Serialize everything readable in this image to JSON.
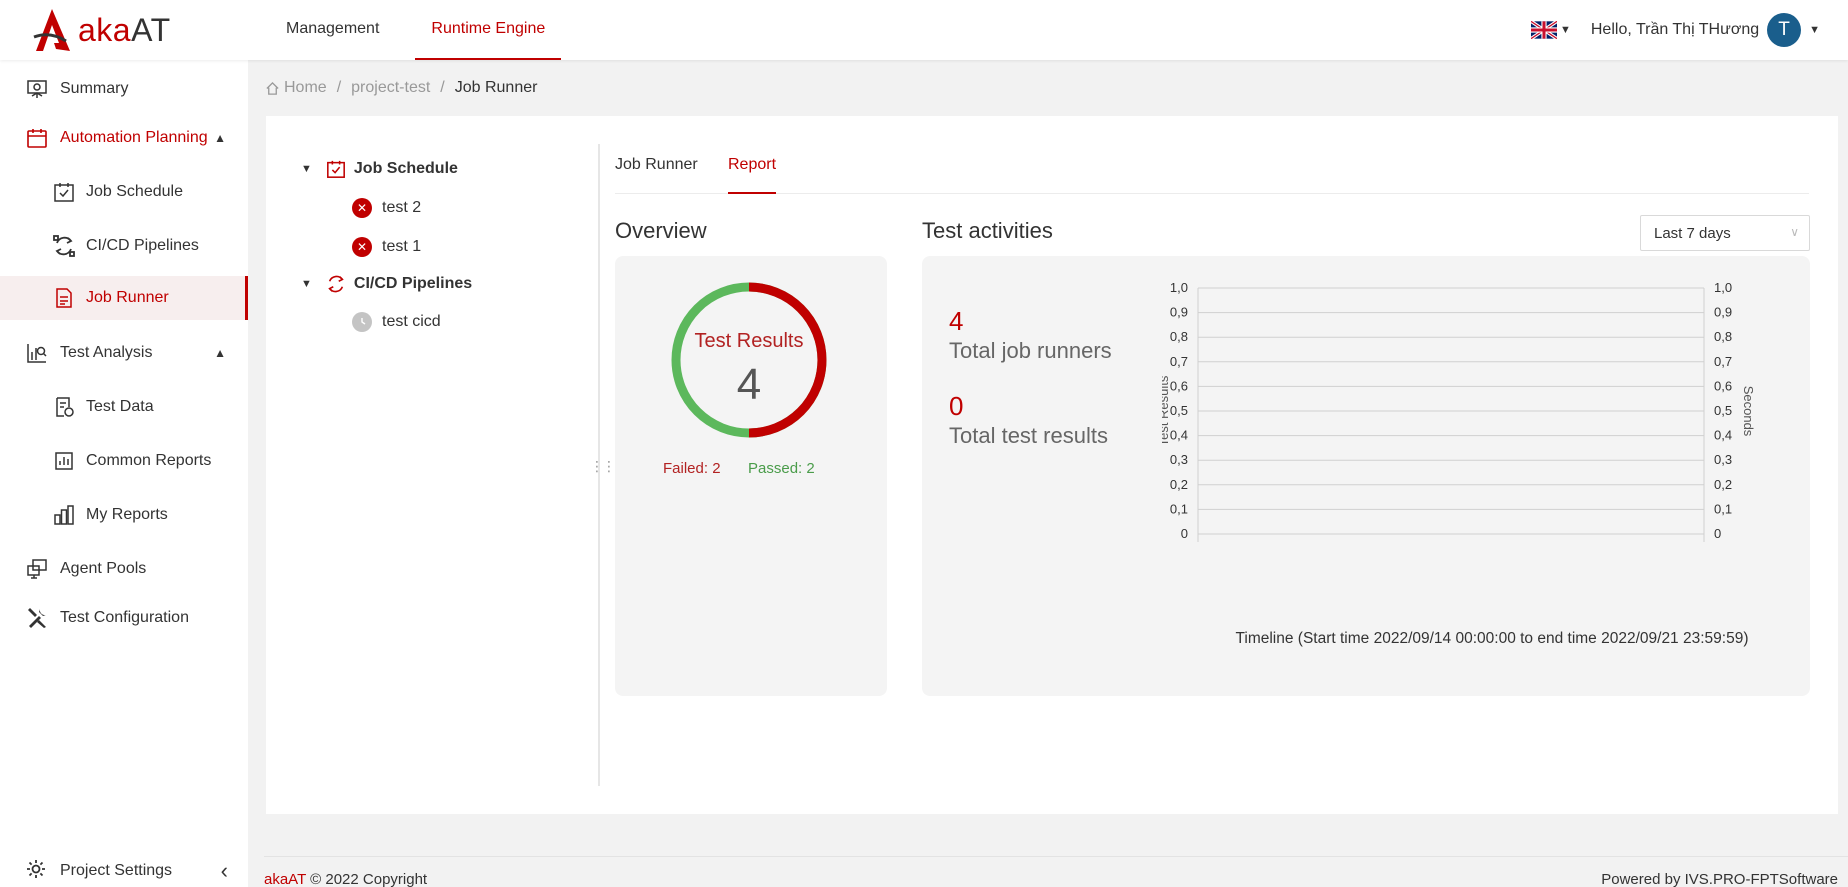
{
  "app": {
    "logo_letter": "A",
    "logo_brand_prefix": "aka",
    "logo_brand_suffix": "AT"
  },
  "topnav": {
    "items": [
      {
        "label": "Management",
        "active": false
      },
      {
        "label": "Runtime Engine",
        "active": true
      }
    ]
  },
  "user": {
    "greeting": "Hello, Trần Thị THương",
    "avatar_initial": "T",
    "avatar_color": "#1a5e8c",
    "language_icon": "uk-flag-icon"
  },
  "sidebar": {
    "summary": "Summary",
    "automation_planning": "Automation Planning",
    "job_schedule": "Job Schedule",
    "cicd_pipelines": "CI/CD Pipelines",
    "job_runner": "Job Runner",
    "test_analysis": "Test Analysis",
    "test_data": "Test Data",
    "common_reports": "Common Reports",
    "my_reports": "My Reports",
    "agent_pools": "Agent Pools",
    "test_configuration": "Test Configuration",
    "project_settings": "Project Settings",
    "active_item": "Job Runner",
    "active_color": "#c00000"
  },
  "breadcrumb": {
    "home": "Home",
    "project": "project-test",
    "current": "Job Runner"
  },
  "tree": {
    "job_schedule": "Job Schedule",
    "test2": "test 2",
    "test1": "test 1",
    "cicd": "CI/CD Pipelines",
    "test_cicd": "test cicd"
  },
  "tabs": {
    "job_runner": "Job Runner",
    "report": "Report",
    "active": "Report"
  },
  "overview": {
    "title": "Overview",
    "donut_label": "Test Results",
    "donut_total": "4",
    "failed_label": "Failed: 2",
    "passed_label": "Passed: 2",
    "failed": 2,
    "passed": 2,
    "failed_color": "#c00000",
    "passed_color": "#5cb85c"
  },
  "activities": {
    "title": "Test activities",
    "range_select": "Last 7 days",
    "total_job_runners_value": "4",
    "total_job_runners_label": "Total job runners",
    "total_test_results_value": "0",
    "total_test_results_label": "Total test results",
    "timeline": "Timeline (Start time 2022/09/14 00:00:00 to end time 2022/09/21 23:59:59)"
  },
  "chart_data": {
    "type": "line",
    "title": "",
    "xlabel": "",
    "ylabel": "Test Results",
    "y2label": "Seconds",
    "ylim": [
      0,
      1
    ],
    "y2lim": [
      0,
      1
    ],
    "yticks": [
      "0",
      "0,1",
      "0,2",
      "0,3",
      "0,4",
      "0,5",
      "0,6",
      "0,7",
      "0,8",
      "0,9",
      "1,0"
    ],
    "series": [],
    "grid": true
  },
  "footer": {
    "brand": "akaAT",
    "copyright": "© 2022 Copyright",
    "powered": "Powered by IVS.PRO-FPTSoftware"
  }
}
